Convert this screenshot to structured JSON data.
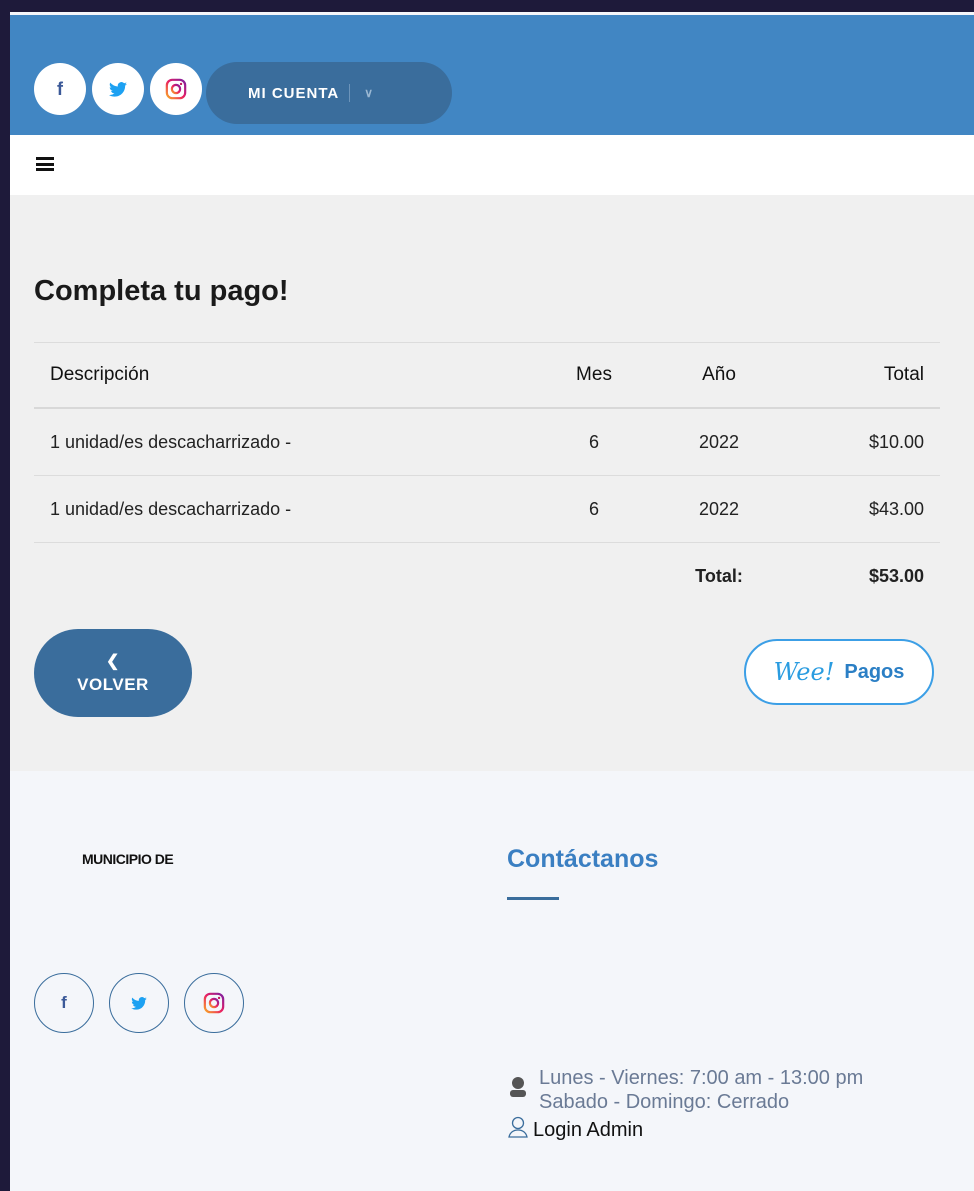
{
  "header": {
    "social": [
      {
        "icon": "facebook-icon",
        "glyph": "f"
      },
      {
        "icon": "twitter-icon",
        "glyph": ""
      },
      {
        "icon": "instagram-icon",
        "glyph": ""
      }
    ],
    "account_label": "MI CUENTA"
  },
  "main": {
    "title": "Completa tu pago!",
    "table": {
      "headers": {
        "desc": "Descripción",
        "mes": "Mes",
        "anio": "Año",
        "total": "Total"
      },
      "rows": [
        {
          "desc": "1 unidad/es descacharrizado -",
          "mes": "6",
          "anio": "2022",
          "total": "$10.00"
        },
        {
          "desc": "1 unidad/es descacharrizado -",
          "mes": "6",
          "anio": "2022",
          "total": "$43.00"
        }
      ],
      "total_label": "Total:",
      "total_value": "$53.00"
    },
    "back_label": "VOLVER",
    "pay": {
      "brand": "Wee!",
      "label": "Pagos"
    }
  },
  "footer": {
    "municipio": "MUNICIPIO DE",
    "contact_title": "Contáctanos",
    "hours_line1": "Lunes - Viernes: 7:00 am - 13:00 pm",
    "hours_line2": "Sabado - Domingo: Cerrado",
    "admin_label": "Login Admin"
  },
  "colors": {
    "header_bg": "#4186c3",
    "account_bg": "#3a6d9c",
    "accent": "#3a7fc2"
  }
}
